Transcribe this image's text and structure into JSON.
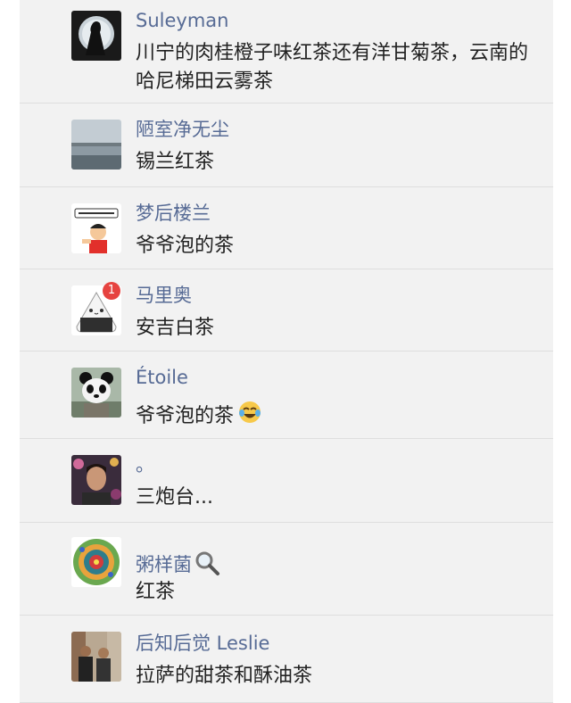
{
  "comments": [
    {
      "name": "Suleyman",
      "text": "川宁的肉桂橙子味红茶还有洋甘菊茶，云南的哈尼梯田云雾茶",
      "avatar_icon": "silhouette-moon-avatar"
    },
    {
      "name": "陋室净无尘",
      "text": "锡兰红茶",
      "avatar_icon": "lake-landscape-avatar"
    },
    {
      "name": "梦后楼兰",
      "text": "爷爷泡的茶",
      "avatar_icon": "cartoon-boy-avatar"
    },
    {
      "name": "马里奥",
      "text": "安吉白茶",
      "avatar_icon": "rice-ball-cartoon-avatar",
      "badge": "1"
    },
    {
      "name": "Étoile",
      "text": "爷爷泡的茶",
      "avatar_icon": "panda-avatar",
      "emoji": "tears-of-joy-emoji"
    },
    {
      "name": "。",
      "text": "三炮台...",
      "avatar_icon": "man-portrait-avatar"
    },
    {
      "name": "粥样菌",
      "text": "红茶",
      "avatar_icon": "colorful-mandala-avatar",
      "name_emoji": "magnifier-emoji"
    },
    {
      "name": "后知后觉 Leslie",
      "text": "拉萨的甜茶和酥油茶",
      "avatar_icon": "group-photo-avatar"
    }
  ],
  "colors": {
    "name": "#576b95",
    "text": "#222222",
    "panel": "#f2f2f2",
    "divider": "#dedede",
    "badge": "#e64340"
  }
}
